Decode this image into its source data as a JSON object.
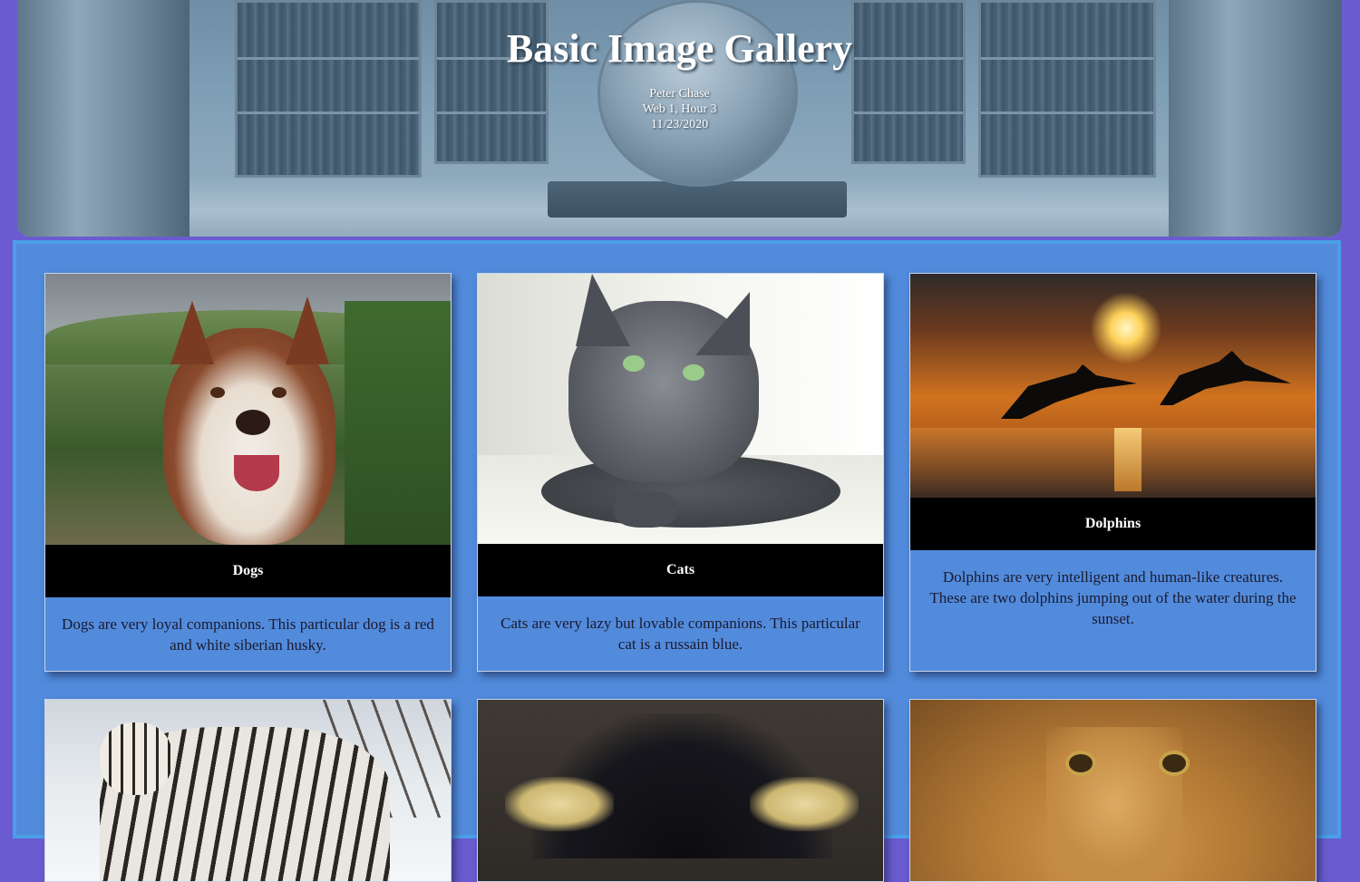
{
  "header": {
    "title": "Basic Image Gallery",
    "author": "Peter Chase",
    "course": "Web 1, Hour 3",
    "date": "11/23/2020"
  },
  "gallery": {
    "cards": [
      {
        "caption": "Dogs",
        "description": "Dogs are very loyal companions. This particular dog is a red and white siberian husky.",
        "image": "husky-photo"
      },
      {
        "caption": "Cats",
        "description": "Cats are very lazy but lovable companions. This particular cat is a russain blue.",
        "image": "russian-blue-cat-photo"
      },
      {
        "caption": "Dolphins",
        "description": "Dolphins are very intelligent and human-like creatures. These are two dolphins jumping out of the water during the sunset.",
        "image": "dolphins-sunset-photo"
      },
      {
        "image": "white-tiger-photo"
      },
      {
        "image": "penguin-photo"
      },
      {
        "image": "lion-photo"
      }
    ]
  },
  "colors": {
    "page_bg": "#6a5bd1",
    "gallery_bg": "#528bdc",
    "gallery_border": "#4aa0e8",
    "caption_bg": "#000000"
  }
}
